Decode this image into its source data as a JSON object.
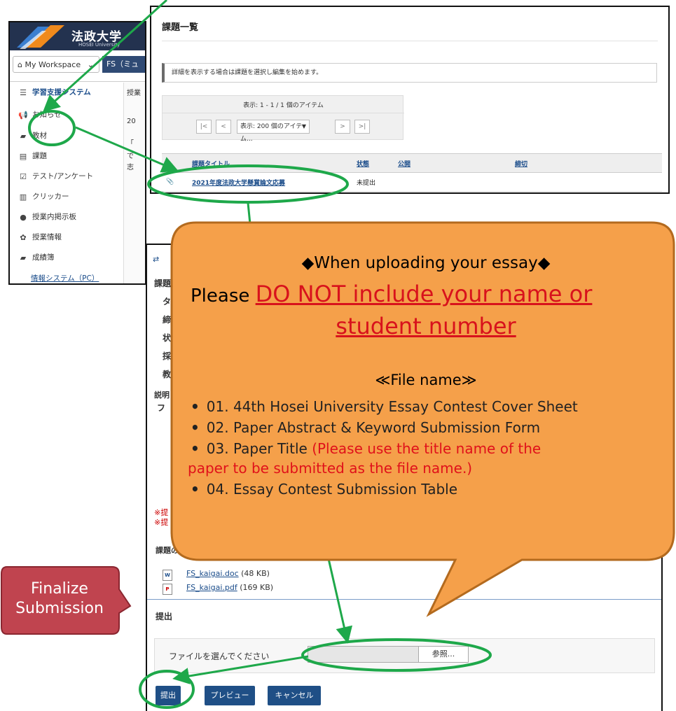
{
  "lms": {
    "brand": "法政大学",
    "brand_sub": "HOSEI University",
    "workspace_label": "My Workspace",
    "site_label": "FS（ミュ",
    "nav": [
      {
        "icon": "list-icon",
        "glyph": "☰",
        "label": "学習支援システム"
      },
      {
        "icon": "megaphone-icon",
        "glyph": "📢",
        "label": "お知らせ"
      },
      {
        "icon": "folder-icon",
        "glyph": "▰",
        "label": "教材"
      },
      {
        "icon": "document-icon",
        "glyph": "▤",
        "label": "課題"
      },
      {
        "icon": "checkbox-icon",
        "glyph": "☑",
        "label": "テスト/アンケート"
      },
      {
        "icon": "bar-chart-icon",
        "glyph": "▥",
        "label": "クリッカー"
      },
      {
        "icon": "chat-icon",
        "glyph": "●",
        "label": "授業内掲示板"
      },
      {
        "icon": "gear-icon",
        "glyph": "✿",
        "label": "授業情報"
      },
      {
        "icon": "book-icon",
        "glyph": "▰",
        "label": "成績簿"
      },
      {
        "icon": "",
        "glyph": "",
        "label": "情報システム（PC）"
      }
    ],
    "col2": [
      "授業",
      "20",
      "「",
      "で",
      "志"
    ]
  },
  "assignment_list": {
    "title": "課題一覧",
    "info": "詳細を表示する場合は課題を選択し編集を始めます。",
    "pager_count": "表示: 1 - 1 / 1 個のアイテム",
    "pager_first": "|<",
    "pager_prev": "<",
    "pager_select": "表示: 200 個のアイテム...",
    "pager_next": ">",
    "pager_last": ">|",
    "columns": [
      "課題タイトル",
      "状態",
      "公開",
      "締切"
    ],
    "rows": [
      {
        "title": "2021年度法政大学懸賞論文応募",
        "status": "未提出",
        "open": "",
        "due": ""
      }
    ]
  },
  "submission": {
    "fragments": [
      "課題",
      "タ",
      "締",
      "状",
      "採",
      "教",
      "説明",
      "フ"
    ],
    "red_fragments": [
      "※提",
      "※提"
    ],
    "add_label": "課題の追加",
    "attachments": [
      {
        "name": "FS_kaigai.doc",
        "size": "(48 KB)",
        "icon": "word-file-icon",
        "glyph": "W"
      },
      {
        "name": "FS_kaigai.pdf",
        "size": "(169 KB)",
        "icon": "pdf-file-icon",
        "glyph": "P"
      }
    ],
    "section_title": "提出",
    "file_label": "ファイルを選んでください",
    "browse": "参照...",
    "submit": "提出",
    "preview": "プレビュー",
    "cancel": "キャンセル"
  },
  "bubble": {
    "heading": "◆When uploading your essay◆",
    "line1_prefix": "Please ",
    "line1_red": "DO NOT include your name or",
    "line2_red": "student number",
    "file_heading": "≪File name≫",
    "items": [
      {
        "text": "01. 44th Hosei University Essay Contest Cover Sheet",
        "note": ""
      },
      {
        "text": "02. Paper Abstract & Keyword Submission Form",
        "note": ""
      },
      {
        "text": "03. Paper Title",
        "note": "(Please use the title name of the"
      },
      {
        "text": "04. Essay Contest Submission Table",
        "note": ""
      }
    ],
    "item3_cont": "paper to be submitted as the file name.)",
    "bullet": "•"
  },
  "finalize": {
    "line1": "Finalize",
    "line2": "Submission"
  },
  "colors": {
    "annotation_green": "#1ea84a",
    "bubble_fill": "#f5a04a",
    "bubble_stroke": "#b36a1e",
    "callout_red": "#c0444f",
    "lms_blue": "#1f4f86",
    "alert_red": "#d8121c"
  }
}
